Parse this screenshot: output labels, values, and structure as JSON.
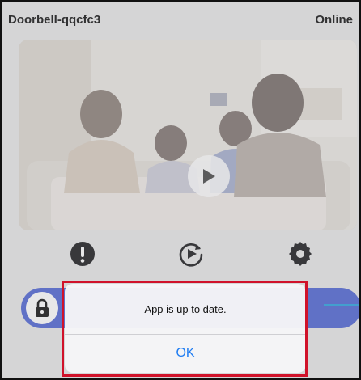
{
  "header": {
    "device_name": "Doorbell-qqcfc3",
    "status": "Online"
  },
  "video": {
    "play_icon": "play-icon"
  },
  "controls": {
    "items": [
      {
        "icon": "alert-icon"
      },
      {
        "icon": "replay-icon"
      },
      {
        "icon": "gear-icon"
      }
    ]
  },
  "unlock_slider": {
    "icon": "lock-icon",
    "accent": "#5b6fd6"
  },
  "dialog": {
    "message": "App is up to date.",
    "ok_label": "OK",
    "ok_color": "#1e7cf2"
  },
  "highlight_color": "#d0122a"
}
